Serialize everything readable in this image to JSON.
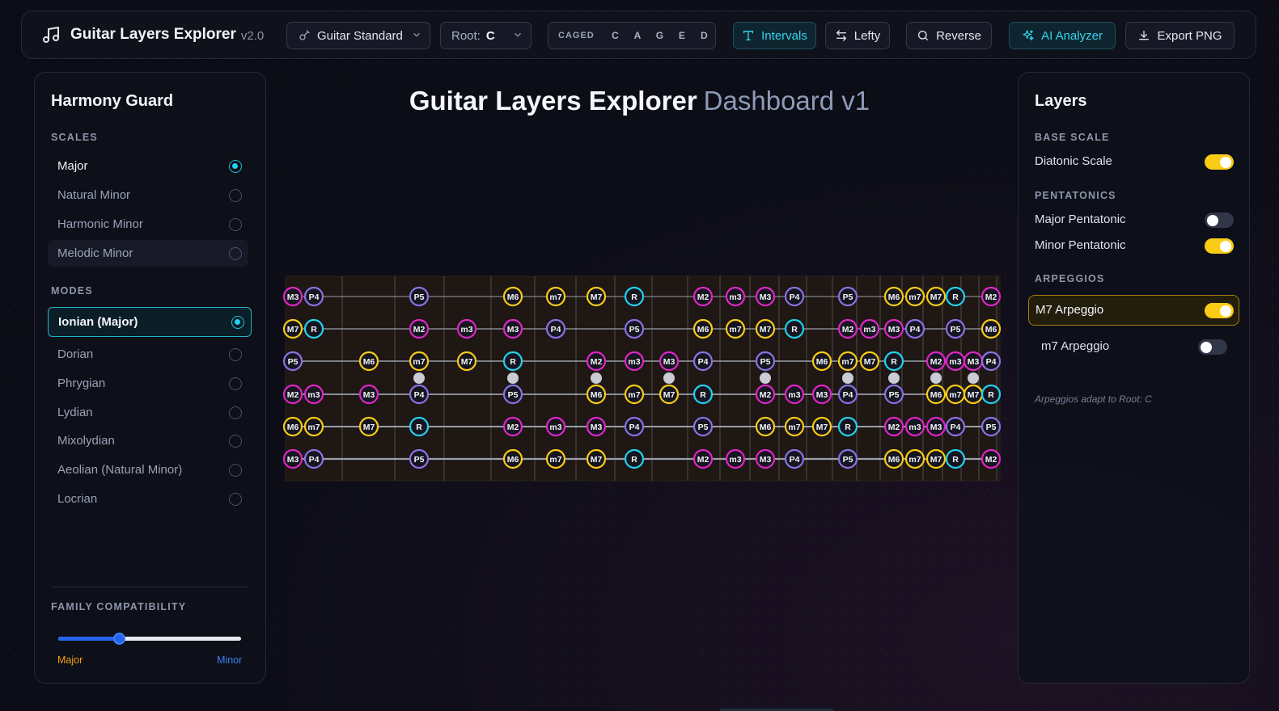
{
  "app": {
    "title": "Guitar Layers Explorer",
    "version": "v2.0"
  },
  "toolbar": {
    "tuning": {
      "label": "Guitar Standard",
      "icon": "guitar-icon"
    },
    "root": {
      "label": "Root:",
      "value": "C"
    },
    "caged": {
      "label": "CAGED",
      "shapes": [
        "C",
        "A",
        "G",
        "E",
        "D"
      ]
    },
    "buttons": {
      "intervals": "Intervals",
      "lefty": "Lefty",
      "reverse": "Reverse",
      "ai": "AI Analyzer",
      "export": "Export PNG"
    }
  },
  "heading": {
    "main": "Guitar Layers Explorer",
    "sub": "Dashboard v1"
  },
  "left": {
    "title": "Harmony Guard",
    "scales_label": "SCALES",
    "scales": [
      {
        "label": "Major",
        "selected": true
      },
      {
        "label": "Natural Minor",
        "selected": false
      },
      {
        "label": "Harmonic Minor",
        "selected": false
      },
      {
        "label": "Melodic Minor",
        "selected": false
      }
    ],
    "modes_label": "MODES",
    "modes": [
      {
        "label": "Ionian (Major)",
        "selected": true
      },
      {
        "label": "Dorian",
        "selected": false
      },
      {
        "label": "Phrygian",
        "selected": false
      },
      {
        "label": "Lydian",
        "selected": false
      },
      {
        "label": "Mixolydian",
        "selected": false
      },
      {
        "label": "Aeolian (Natural Minor)",
        "selected": false
      },
      {
        "label": "Locrian",
        "selected": false
      }
    ],
    "family_label": "FAMILY COMPATIBILITY",
    "family_value": 0.33,
    "family_min": "Major",
    "family_max": "Minor"
  },
  "right": {
    "title": "Layers",
    "base_label": "BASE SCALE",
    "diatonic": {
      "label": "Diatonic Scale",
      "on": true
    },
    "pent_label": "PENTATONICS",
    "major_pent": {
      "label": "Major Pentatonic",
      "on": false
    },
    "minor_pent": {
      "label": "Minor Pentatonic",
      "on": true
    },
    "arp_label": "ARPEGGIOS",
    "m7_maj_arp": {
      "label": "M7 Arpeggio",
      "on": true
    },
    "m7_min_arp": {
      "label": "m7 Arpeggio",
      "on": false
    },
    "note": "Arpeggios adapt to Root: C"
  },
  "colors": {
    "accent": "#22d3ee",
    "yellow": "#facc15",
    "magenta": "#e026c9",
    "purple": "#8b72e6",
    "cyan": "#22d3ee",
    "panel_bg": "#0e101a"
  },
  "fretboard": {
    "strings": [
      [
        [
          "M3",
          "m"
        ],
        [
          "P4",
          "p"
        ],
        [
          "P5",
          "p"
        ],
        [
          "M6",
          "y"
        ],
        [
          "m7",
          "y"
        ],
        [
          "M7",
          "y"
        ],
        [
          "R",
          "c"
        ],
        [
          "M2",
          "m"
        ],
        [
          "m3",
          "m"
        ],
        [
          "M3",
          "m"
        ],
        [
          "P4",
          "p"
        ],
        [
          "P5",
          "p"
        ],
        [
          "M6",
          "y"
        ],
        [
          "m7",
          "y"
        ],
        [
          "M7",
          "y"
        ],
        [
          "R",
          "c"
        ],
        [
          "M2",
          "m"
        ]
      ],
      [
        [
          "M7",
          "y"
        ],
        [
          "R",
          "c"
        ],
        [
          "M2",
          "m"
        ],
        [
          "m3",
          "m"
        ],
        [
          "M3",
          "m"
        ],
        [
          "P4",
          "p"
        ],
        [
          "P5",
          "p"
        ],
        [
          "M6",
          "y"
        ],
        [
          "m7",
          "y"
        ],
        [
          "M7",
          "y"
        ],
        [
          "R",
          "c"
        ],
        [
          "M2",
          "m"
        ],
        [
          "m3",
          "m"
        ],
        [
          "M3",
          "m"
        ],
        [
          "P4",
          "p"
        ],
        [
          "P5",
          "p"
        ],
        [
          "M6",
          "y"
        ]
      ],
      [
        [
          "P5",
          "p"
        ],
        [
          "M6",
          "y"
        ],
        [
          "m7",
          "y"
        ],
        [
          "M7",
          "y"
        ],
        [
          "R",
          "c"
        ],
        [
          "M2",
          "m"
        ],
        [
          "m3",
          "m"
        ],
        [
          "M3",
          "m"
        ],
        [
          "P4",
          "p"
        ],
        [
          "P5",
          "p"
        ],
        [
          "M6",
          "y"
        ],
        [
          "m7",
          "y"
        ],
        [
          "M7",
          "y"
        ],
        [
          "R",
          "c"
        ],
        [
          "M2",
          "m"
        ],
        [
          "m3",
          "m"
        ],
        [
          "M3",
          "m"
        ],
        [
          "P4",
          "p"
        ]
      ],
      [
        [
          "M2",
          "m"
        ],
        [
          "m3",
          "m"
        ],
        [
          "M3",
          "m"
        ],
        [
          "P4",
          "p"
        ],
        [
          "P5",
          "p"
        ],
        [
          "M6",
          "y"
        ],
        [
          "m7",
          "y"
        ],
        [
          "M7",
          "y"
        ],
        [
          "R",
          "c"
        ],
        [
          "M2",
          "m"
        ],
        [
          "m3",
          "m"
        ],
        [
          "M3",
          "m"
        ],
        [
          "P4",
          "p"
        ],
        [
          "P5",
          "p"
        ],
        [
          "M6",
          "y"
        ],
        [
          "m7",
          "y"
        ],
        [
          "M7",
          "y"
        ],
        [
          "R",
          "c"
        ]
      ],
      [
        [
          "M6",
          "y"
        ],
        [
          "m7",
          "y"
        ],
        [
          "M7",
          "y"
        ],
        [
          "R",
          "c"
        ],
        [
          "M2",
          "m"
        ],
        [
          "m3",
          "m"
        ],
        [
          "M3",
          "m"
        ],
        [
          "P4",
          "p"
        ],
        [
          "P5",
          "p"
        ],
        [
          "M6",
          "y"
        ],
        [
          "m7",
          "y"
        ],
        [
          "M7",
          "y"
        ],
        [
          "R",
          "c"
        ],
        [
          "M2",
          "m"
        ],
        [
          "m3",
          "m"
        ],
        [
          "M3",
          "m"
        ],
        [
          "P4",
          "p"
        ],
        [
          "P5",
          "p"
        ]
      ],
      [
        [
          "M3",
          "m"
        ],
        [
          "P4",
          "p"
        ],
        [
          "P5",
          "p"
        ],
        [
          "M6",
          "y"
        ],
        [
          "m7",
          "y"
        ],
        [
          "M7",
          "y"
        ],
        [
          "R",
          "c"
        ],
        [
          "M2",
          "m"
        ],
        [
          "m3",
          "m"
        ],
        [
          "M3",
          "m"
        ],
        [
          "P4",
          "p"
        ],
        [
          "P5",
          "p"
        ],
        [
          "M6",
          "y"
        ],
        [
          "m7",
          "y"
        ],
        [
          "M7",
          "y"
        ],
        [
          "R",
          "c"
        ],
        [
          "M2",
          "m"
        ]
      ]
    ]
  }
}
